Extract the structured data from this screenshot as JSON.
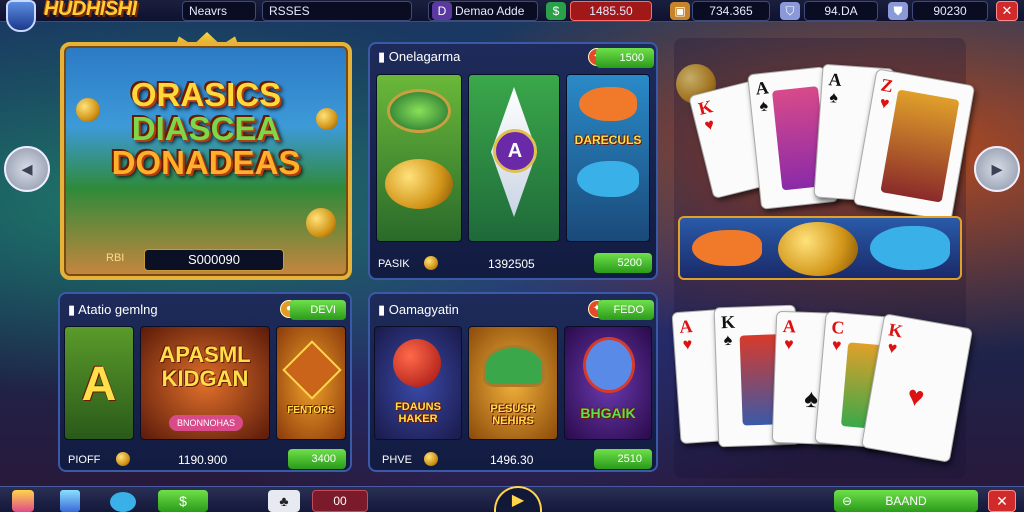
{
  "header": {
    "logo_text": "HUDHISHI",
    "tab_1": "Neavrs",
    "tab_2": "RSSES",
    "demo_label": "Demao Adde",
    "stat_1": "1485.50",
    "stat_2": "734.365",
    "stat_3": "94.DA",
    "stat_4": "90230",
    "close": "✕"
  },
  "featured": {
    "title_line1": "ORASICS",
    "title_line2": "DIASCEA",
    "title_line3": "DONADEAS",
    "label": "RBI",
    "value": "S000090"
  },
  "panel_top_center": {
    "title": "Onelagarma",
    "badge": "1500",
    "tile_text": "DARECULS",
    "footer_label": "PASIK",
    "footer_value": "1392505",
    "footer_badge": "5200"
  },
  "panel_bottom_left": {
    "title": "Atatio gemlng",
    "badge": "DEVI",
    "tile_a": "A",
    "tile_main_1": "APASML",
    "tile_main_2": "KIDGAN",
    "tile_main_sub": "BNONNOHAS",
    "tile_right": "FENTORS",
    "footer_label": "PIOFF",
    "footer_value": "1190.900",
    "footer_badge": "3400"
  },
  "panel_bottom_center": {
    "title": "Oamagyatin",
    "badge": "FEDO",
    "tile_1": "FDAUNS HAKER",
    "tile_2": "PESUSR NEHIRS",
    "tile_3": "BHGAIK",
    "footer_label": "PHVE",
    "footer_value": "1496.30",
    "footer_badge": "2510"
  },
  "cards_top": [
    "K",
    "A",
    "A",
    "Z"
  ],
  "cards_bottom": [
    "A",
    "K",
    "A",
    "C",
    "K"
  ],
  "bottom_bar": {
    "button_1": "00",
    "action_label": "BAAND"
  },
  "colors": {
    "gold": "#ffd93a",
    "panel_border": "#3a5aa8",
    "green_badge": "#2a9a1a",
    "close_red": "#d12a2a"
  }
}
